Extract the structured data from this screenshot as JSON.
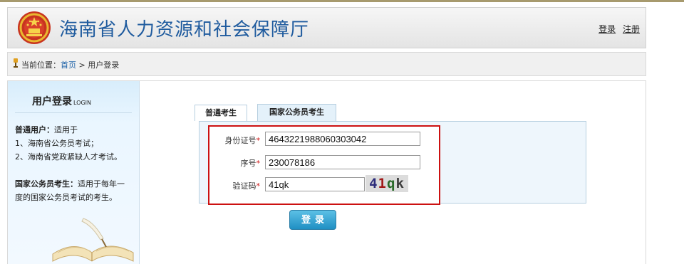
{
  "header": {
    "site_title": "海南省人力资源和社会保障厅",
    "login_link": "登录",
    "register_link": "注册"
  },
  "breadcrumb": {
    "prefix": "当前位置：",
    "home": "首页",
    "separator": " > ",
    "current": "用户登录"
  },
  "sidebar": {
    "title": "用户登录",
    "title_en": "LOGIN",
    "normal_user_label": "普通用户：",
    "normal_user_suffix": "适用于",
    "normal_user_item1": "1、海南省公务员考试；",
    "normal_user_item2": "2、海南省党政紧缺人才考试。",
    "national_label": "国家公务员考生：",
    "national_text1": "适用于每年一",
    "national_text2": "度的国家公务员考试的考生。"
  },
  "tabs": [
    {
      "label": "普通考生"
    },
    {
      "label": "国家公务员考生"
    }
  ],
  "form": {
    "id_label": "身份证号",
    "id_value": "4643221988060303042",
    "seq_label": "序号",
    "seq_value": "230078186",
    "captcha_label": "验证码",
    "captcha_value": "41qk",
    "captcha_chars": [
      "4",
      "1",
      "q",
      "k"
    ],
    "required_mark": "*"
  },
  "login_button": "登录",
  "colors": {
    "title_blue": "#1f5b9e",
    "highlight_red": "#cc1111",
    "button_blue": "#1f8fc3"
  }
}
